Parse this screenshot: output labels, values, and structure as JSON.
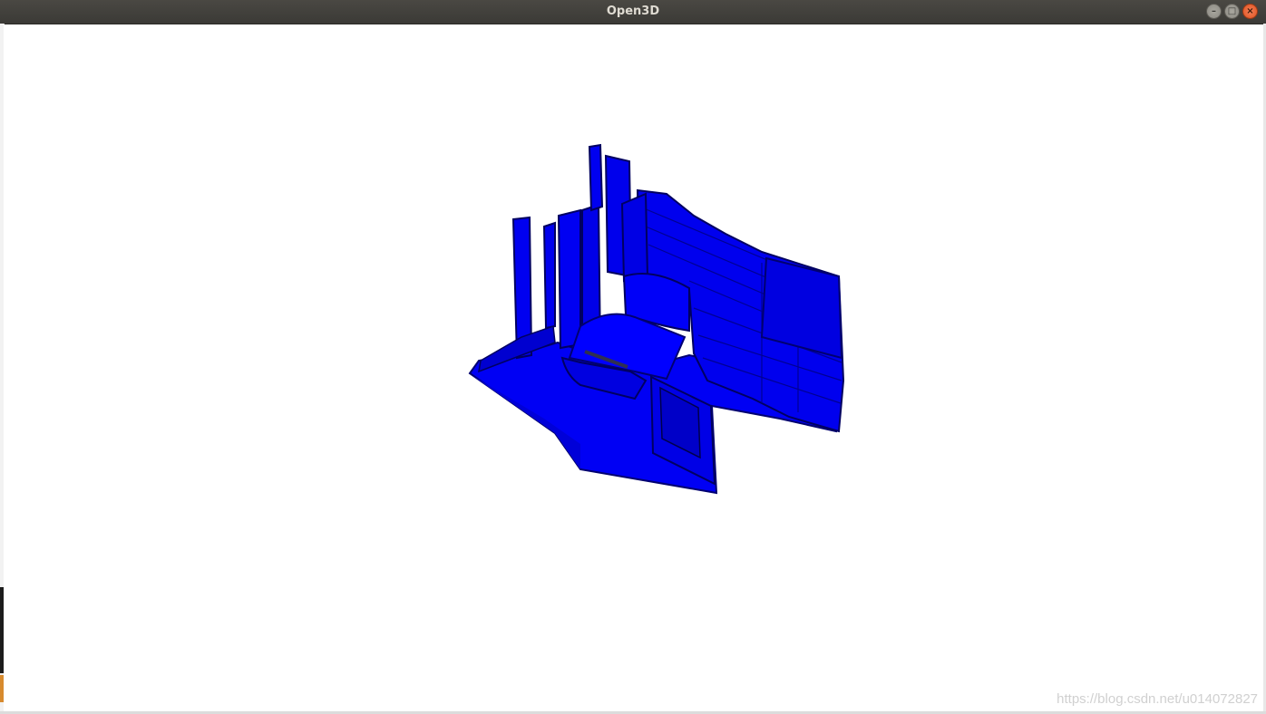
{
  "window": {
    "title": "Open3D",
    "buttons": {
      "minimize_icon": "minimize-icon",
      "maximize_icon": "maximize-icon",
      "close_icon": "close-icon"
    }
  },
  "viewport": {
    "background_color": "#ffffff",
    "point_cloud_color": "#0000ff",
    "shadow_color": "#000080"
  },
  "watermark": {
    "text": "https://blog.csdn.net/u014072827"
  }
}
